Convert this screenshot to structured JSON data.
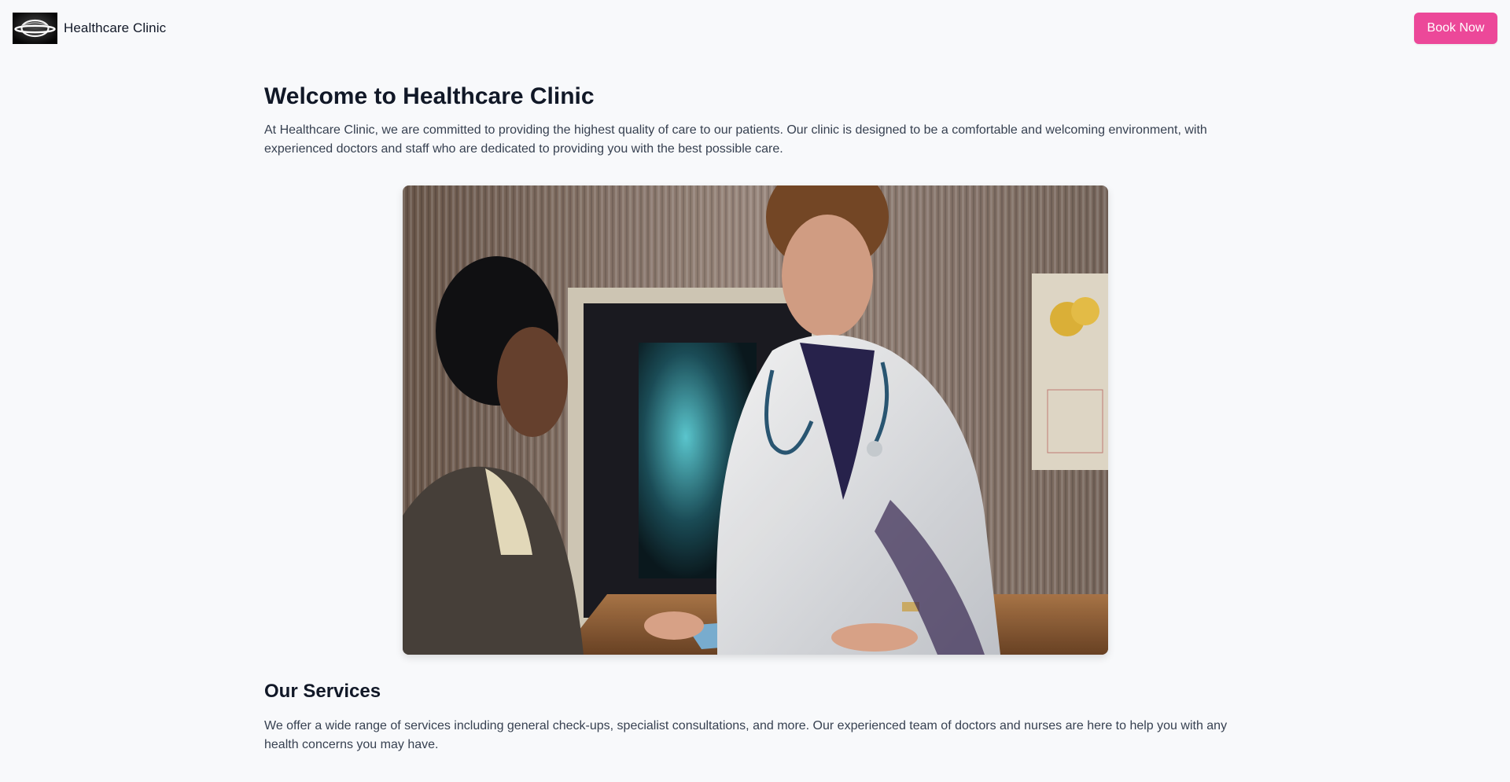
{
  "header": {
    "brand_name": "Healthcare Clinic",
    "book_button_label": "Book Now",
    "accent_color": "#ec4899"
  },
  "hero": {
    "title": "Welcome to Healthcare Clinic",
    "description": "At Healthcare Clinic, we are committed to providing the highest quality of care to our patients. Our clinic is designed to be a comfortable and welcoming environment, with experienced doctors and staff who are dedicated to providing you with the best possible care."
  },
  "services": {
    "title": "Our Services",
    "description": "We offer a wide range of services including general check-ups, specialist consultations, and more. Our experienced team of doctors and nurses are here to help you with any health concerns you may have."
  },
  "icons": {
    "logo": "planet-ring-logo-icon"
  }
}
